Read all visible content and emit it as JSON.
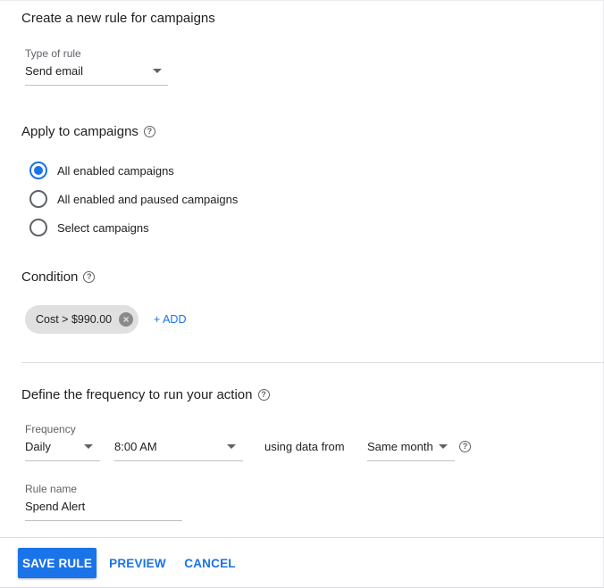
{
  "page": {
    "title": "Create a new rule for campaigns"
  },
  "rule_type": {
    "label": "Type of rule",
    "value": "Send email"
  },
  "apply": {
    "title": "Apply to campaigns",
    "options": [
      {
        "label": "All enabled campaigns",
        "selected": true
      },
      {
        "label": "All enabled and paused campaigns",
        "selected": false
      },
      {
        "label": "Select campaigns",
        "selected": false
      }
    ]
  },
  "condition": {
    "title": "Condition",
    "chip": "Cost > $990.00",
    "add_label": "+ ADD"
  },
  "frequency": {
    "title": "Define the frequency to run your action",
    "label": "Frequency",
    "value": "Daily",
    "time": "8:00 AM",
    "using_text": "using data from",
    "data_range": "Same month"
  },
  "rule_name": {
    "label": "Rule name",
    "value": "Spend Alert"
  },
  "actions": {
    "save": "SAVE RULE",
    "preview": "PREVIEW",
    "cancel": "CANCEL"
  },
  "colors": {
    "accent": "#1a73e8",
    "chip_bg": "#e0e0e0",
    "text": "#202124",
    "muted": "#5f6368"
  }
}
